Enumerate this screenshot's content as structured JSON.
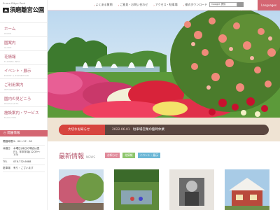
{
  "brand": {
    "name_en": "Suma Rikyu Park",
    "name_ja": "須磨離宮公園"
  },
  "sidebar": {
    "items": [
      {
        "label": "ホーム",
        "sub": "HOME"
      },
      {
        "label": "園案内",
        "sub": "GUIDE"
      },
      {
        "label": "花情報",
        "sub": "FLOWER INFO"
      },
      {
        "label": "イベント・展示",
        "sub": "EVENT & EXHIBITION"
      },
      {
        "label": "ご利用案内",
        "sub": "INFORMATION"
      },
      {
        "label": "園内の見どころ",
        "sub": "HIGHLIGHTS"
      },
      {
        "label": "施設案内・サービス",
        "sub": "FACILITIES"
      }
    ],
    "access_label": "開園情報"
  },
  "info": [
    {
      "key": "開園時間",
      "value": "9：00～17：00"
    },
    {
      "key": "休園日",
      "value": "木曜日(休日の場合は翌日)、年末年始(12/29～1/3)"
    },
    {
      "key": "TEL",
      "value": "078-732-6688"
    },
    {
      "key": "駐車場",
      "value": "有り・ございます"
    }
  ],
  "header": {
    "links": [
      "よくある質問",
      "ご意見・お問い合わせ",
      "アクセス・駐車場",
      "様式ダウンロード"
    ],
    "search_placeholder": "Google 提供",
    "language_label": "Languages"
  },
  "notice": {
    "tag": "大切なお知らせ",
    "date": "2022.06.01",
    "text": "駐車場営業の臨時休業"
  },
  "news": {
    "title": "最新情報",
    "title_en": "NEWS",
    "tags": [
      {
        "label": "お知らせ",
        "color": "#e08a9a"
      },
      {
        "label": "花情報",
        "color": "#8cc56b"
      },
      {
        "label": "イベント・展示",
        "color": "#6cb7d6"
      }
    ]
  },
  "colors": {
    "accent": "#d46672",
    "label_pink": "#b4556b",
    "band": "#efe3d3",
    "notice_bg": "#5a4640",
    "notice_tag": "#d7443f"
  }
}
